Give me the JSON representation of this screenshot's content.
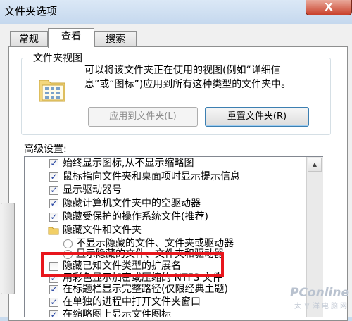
{
  "window": {
    "title": "文件夹选项",
    "close_glyph": "X"
  },
  "tabs": [
    {
      "label": "常规",
      "active": false
    },
    {
      "label": "查看",
      "active": true
    },
    {
      "label": "搜索",
      "active": false
    }
  ],
  "folder_views": {
    "group_title": "文件夹视图",
    "description": "可以将该文件夹正在使用的视图(例如“详细信息”或“图标”)应用到所有这种类型的文件夹中。",
    "apply_button": "应用到文件夹(L)",
    "reset_button": "重置文件夹(R)"
  },
  "advanced": {
    "label": "高级设置:",
    "items": [
      {
        "type": "checkbox",
        "checked": true,
        "label": "始终显示图标,从不显示缩略图"
      },
      {
        "type": "checkbox",
        "checked": true,
        "label": "鼠标指向文件夹和桌面项时显示提示信息"
      },
      {
        "type": "checkbox",
        "checked": true,
        "label": "显示驱动器号"
      },
      {
        "type": "checkbox",
        "checked": true,
        "label": "隐藏计算机文件夹中的空驱动器"
      },
      {
        "type": "checkbox",
        "checked": true,
        "label": "隐藏受保护的操作系统文件(推荐)"
      },
      {
        "type": "folder",
        "label": "隐藏文件和文件夹"
      },
      {
        "type": "radio",
        "checked": false,
        "label": "不显示隐藏的文件、文件夹或驱动器"
      },
      {
        "type": "radio",
        "checked": false,
        "label": "显示隐藏的文件、文件夹和驱动器"
      },
      {
        "type": "checkbox",
        "checked": false,
        "label": "隐藏已知文件类型的扩展名"
      },
      {
        "type": "checkbox",
        "checked": true,
        "label": "用彩色显示加密或压缩的 NTFS 文件"
      },
      {
        "type": "checkbox",
        "checked": true,
        "label": "在标题栏显示完整路径(仅限经典主题)"
      },
      {
        "type": "checkbox",
        "checked": true,
        "label": "在单独的进程中打开文件夹窗口"
      },
      {
        "type": "checkbox",
        "checked": true,
        "label": "在缩略图上显示文件图标"
      }
    ]
  },
  "scrollbar": {
    "up_glyph": "▲",
    "down_glyph": "▼"
  },
  "watermark": {
    "main": "PConline",
    "sub": "太平洋电脑网"
  },
  "colors": {
    "highlight_border": "#e8161c",
    "checkmark": "#1f3f9f"
  }
}
